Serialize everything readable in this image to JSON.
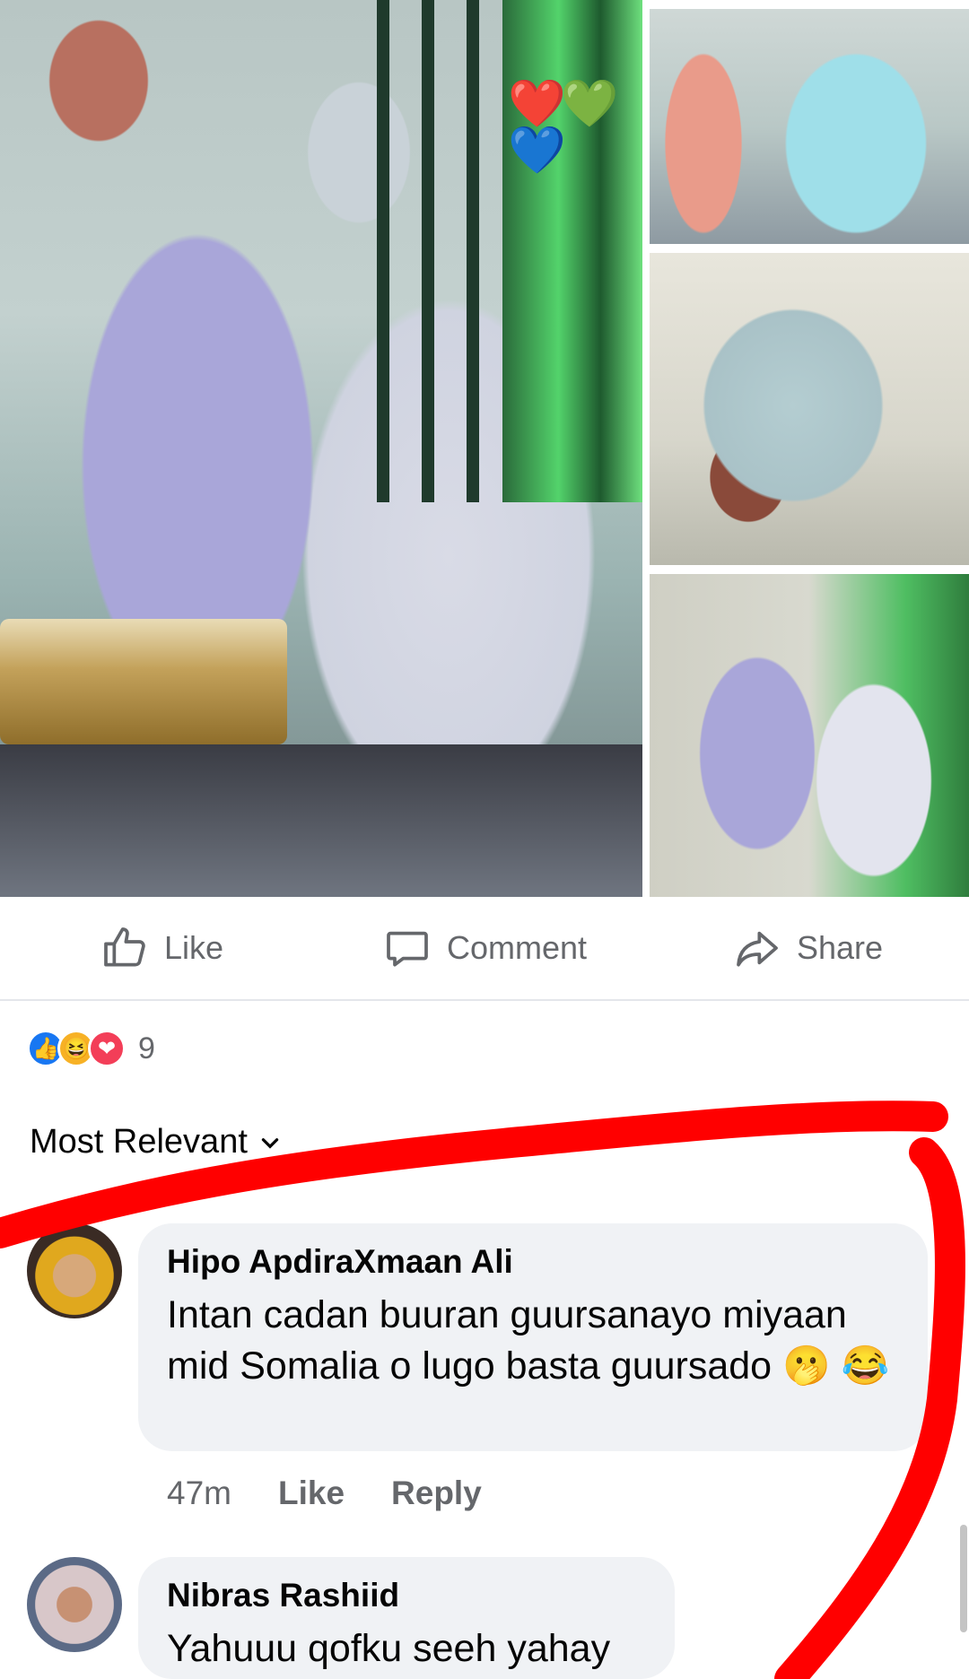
{
  "post": {
    "photo_overlay_hearts": "❤️💚💙"
  },
  "actions": {
    "like_label": "Like",
    "comment_label": "Comment",
    "share_label": "Share"
  },
  "reactions": {
    "count": "9",
    "like_emoji": "👍",
    "haha_emoji": "😆",
    "love_emoji": "❤"
  },
  "sort": {
    "label": "Most Relevant"
  },
  "comments": [
    {
      "author": "Hipo ApdiraXmaan Ali",
      "text": "Intan cadan buuran guursanayo miyaan mid Somalia o lugo basta guursado 🫢 😂",
      "time": "47m",
      "like_label": "Like",
      "reply_label": "Reply"
    },
    {
      "author": "Nibras Rashiid",
      "text": "Yahuuu qofku seeh yahay"
    }
  ],
  "colors": {
    "annotation_red": "#ff0000",
    "fb_blue": "#1877f2",
    "secondary_text": "#65676b",
    "bubble_bg": "#f0f2f5"
  }
}
